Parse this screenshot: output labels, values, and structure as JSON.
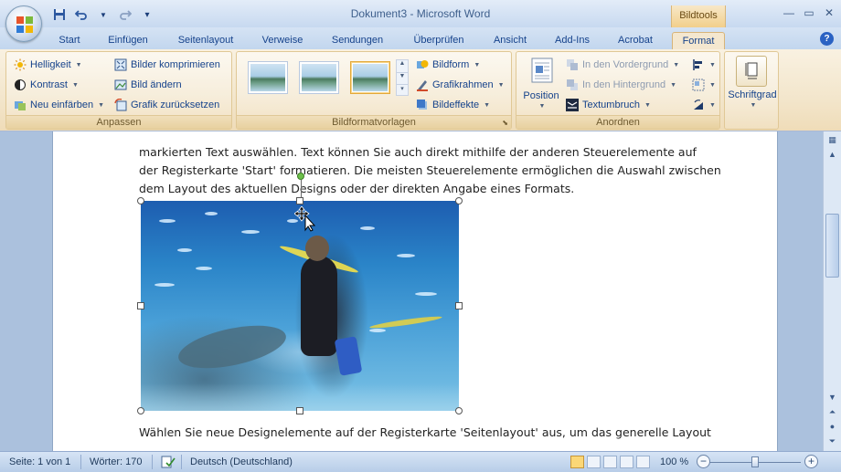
{
  "window": {
    "title": "Dokument3 - Microsoft Word",
    "contextual_tab_title": "Bildtools"
  },
  "quick_access": {
    "save_icon": "save-icon",
    "undo_icon": "undo-icon",
    "redo_icon": "redo-icon",
    "customize_icon": "customize-qat-icon"
  },
  "tabs": [
    {
      "label": "Start"
    },
    {
      "label": "Einfügen"
    },
    {
      "label": "Seitenlayout"
    },
    {
      "label": "Verweise"
    },
    {
      "label": "Sendungen"
    },
    {
      "label": "Überprüfen"
    },
    {
      "label": "Ansicht"
    },
    {
      "label": "Add-Ins"
    },
    {
      "label": "Acrobat"
    },
    {
      "label": "Format",
      "active": true
    }
  ],
  "help_label": "?",
  "ribbon": {
    "anpassen": {
      "label": "Anpassen",
      "helligkeit": "Helligkeit",
      "kontrast": "Kontrast",
      "neu_einfaerben": "Neu einfärben",
      "bilder_komprimieren": "Bilder komprimieren",
      "bild_aendern": "Bild ändern",
      "grafik_zuruecksetzen": "Grafik zurücksetzen"
    },
    "bildformatvorlagen": {
      "label": "Bildformatvorlagen",
      "bildform": "Bildform",
      "grafikrahmen": "Grafikrahmen",
      "bildeffekte": "Bildeffekte",
      "thumbnails": 3,
      "selected_thumbnail": 3
    },
    "anordnen": {
      "label": "Anordnen",
      "position": "Position",
      "vordergrund": "In den Vordergrund",
      "hintergrund": "In den Hintergrund",
      "textumbruch": "Textumbruch"
    },
    "schriftgrad": {
      "label": "Schriftgrad"
    }
  },
  "document": {
    "line1": "markierten Text auswählen. Text können Sie auch direkt mithilfe der anderen Steuerelemente auf",
    "line2": "der Registerkarte 'Start' formatieren. Die meisten Steuerelemente ermöglichen die Auswahl zwischen",
    "line3": "dem Layout des aktuellen Designs oder der direkten Angabe eines Formats.",
    "line4": "Wählen Sie neue Designelemente auf der Registerkarte 'Seitenlayout' aus, um das generelle Layout"
  },
  "status": {
    "page": "Seite: 1 von 1",
    "words": "Wörter: 170",
    "language": "Deutsch (Deutschland)",
    "zoom": "100 %",
    "zoom_minus": "−",
    "zoom_plus": "+"
  },
  "colors": {
    "active_tab": "#f4e7cf",
    "ribbon": "#f3e6cc",
    "accent": "#15428b"
  }
}
